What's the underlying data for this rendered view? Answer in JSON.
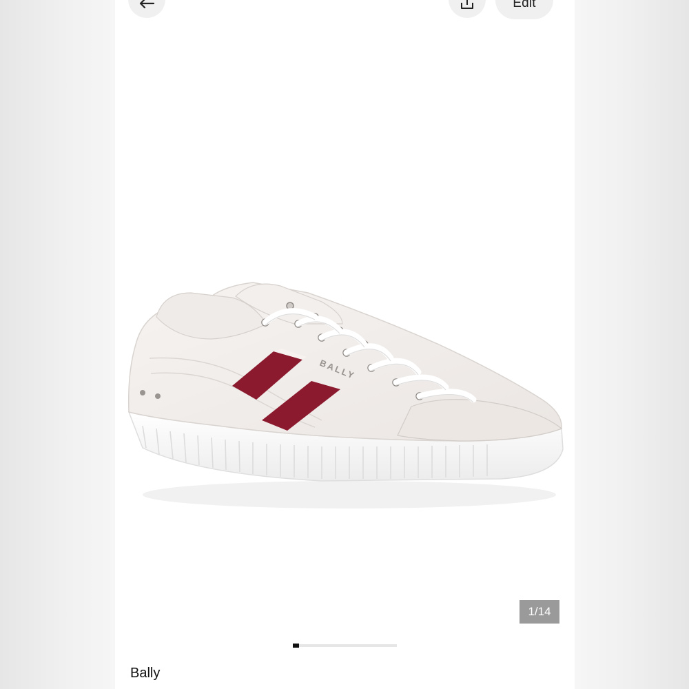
{
  "header": {
    "back_icon": "arrow-left-icon",
    "share_icon": "share-icon",
    "edit_label": "Edit"
  },
  "product": {
    "image_alt": "White Bally sneaker with red stripes",
    "logo_text": "BALLY",
    "image_counter": "1/14",
    "brand": "Bally"
  },
  "colors": {
    "stripe_red": "#8b1a2e",
    "counter_bg": "#9a9a9a"
  }
}
